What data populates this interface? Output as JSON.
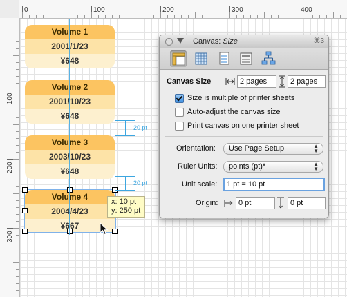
{
  "rulers": {
    "horizontal": [
      "0",
      "100",
      "200",
      "300",
      "400"
    ],
    "vertical": [
      "100",
      "200",
      "300"
    ]
  },
  "cards": [
    {
      "title": "Volume 1",
      "date": "2001/1/23",
      "price": "¥648"
    },
    {
      "title": "Volume 2",
      "date": "2001/10/23",
      "price": "¥648"
    },
    {
      "title": "Volume 3",
      "date": "2003/10/23",
      "price": "¥648"
    },
    {
      "title": "Volume 4",
      "date": "2004/4/23",
      "price": "¥667"
    }
  ],
  "spacing_labels": [
    "20 pt",
    "20 pt"
  ],
  "tooltip": {
    "x": "x: 10 pt",
    "y": "y: 250 pt"
  },
  "inspector": {
    "title_prefix": "Canvas: ",
    "title_suffix": "Size",
    "shortcut": "⌘3",
    "toolbar_icons": [
      "canvas-size-icon",
      "grid-icon",
      "canvas-layers-icon",
      "layout-icon",
      "diagram-layout-icon"
    ],
    "section_title": "Canvas Size",
    "width_pages": "2 pages",
    "height_pages": "2 pages",
    "checkboxes": [
      {
        "label": "Size is multiple of printer sheets",
        "checked": true
      },
      {
        "label": "Auto-adjust the canvas size",
        "checked": false
      },
      {
        "label": "Print canvas on one printer sheet",
        "checked": false
      }
    ],
    "orientation_label": "Orientation:",
    "orientation_value": "Use Page Setup",
    "ruler_units_label": "Ruler Units:",
    "ruler_units_value": "points (pt)*",
    "unit_scale_label": "Unit scale:",
    "unit_scale_value": "1 pt = 10 pt",
    "origin_label": "Origin:",
    "origin_x": "0 pt",
    "origin_y": "0 pt"
  },
  "colors": {
    "card_header": "#fcc461",
    "card_middle": "#fde3a7",
    "card_bottom": "#fdf0cf",
    "guide_blue": "#3da6e0",
    "selection": "#7fb2ea"
  }
}
